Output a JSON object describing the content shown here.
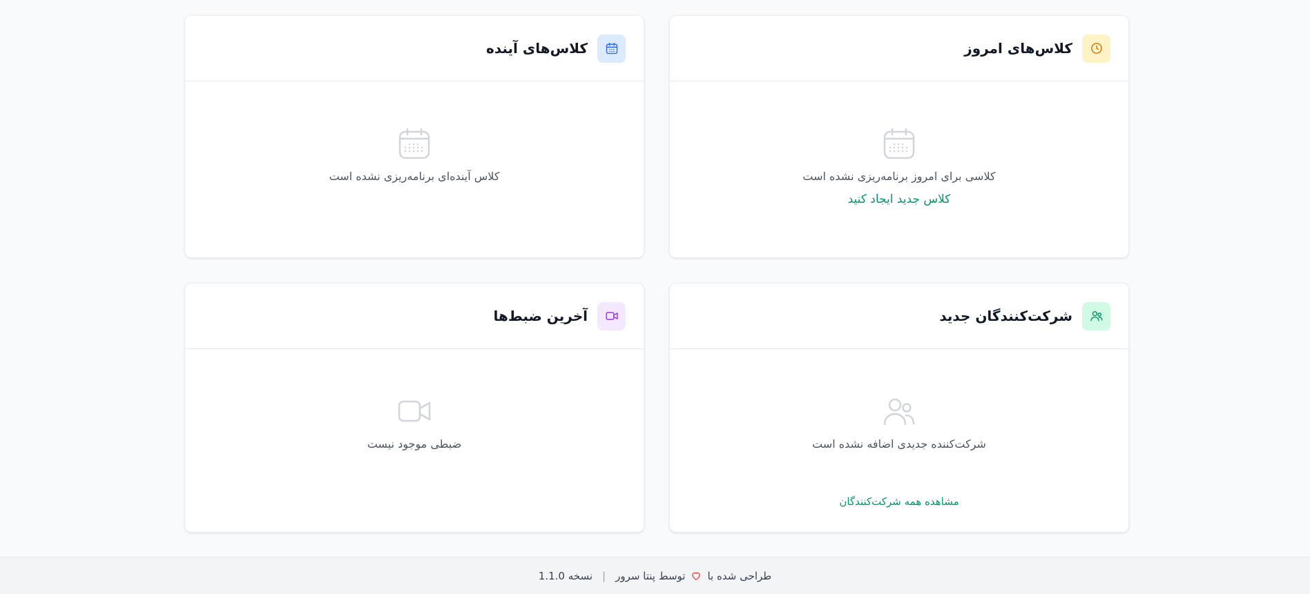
{
  "today_classes": {
    "title": "کلاس‌های امروز",
    "icon": "clock-icon",
    "empty_text": "کلاسی برای امروز برنامه‌ریزی نشده است",
    "action_label": "کلاس جدید ایجاد کنید"
  },
  "upcoming_classes": {
    "title": "کلاس‌های آینده",
    "icon": "calendar-icon",
    "empty_text": "کلاس آینده‌ای برنامه‌ریزی نشده است"
  },
  "new_participants": {
    "title": "شرکت‌کنندگان جدید",
    "icon": "users-icon",
    "empty_text": "شرکت‌کننده جدیدی اضافه نشده است",
    "view_all_label": "مشاهده همه شرکت‌کنندگان"
  },
  "recent_recordings": {
    "title": "آخرین ضبط‌ها",
    "icon": "video-icon",
    "empty_text": "ضبطی موجود نیست"
  },
  "footer": {
    "designed_with": "طراحی شده با",
    "by_text": "توسط پنتا سرور",
    "version_text": "نسخه 1.1.0",
    "separator": "|"
  },
  "colors": {
    "accent_green": "#059669",
    "badge_yellow": "#fef3c7",
    "badge_blue": "#dbeafe",
    "badge_green": "#d1fae5",
    "badge_purple": "#f3e8ff",
    "heart_red": "#ef4444"
  }
}
